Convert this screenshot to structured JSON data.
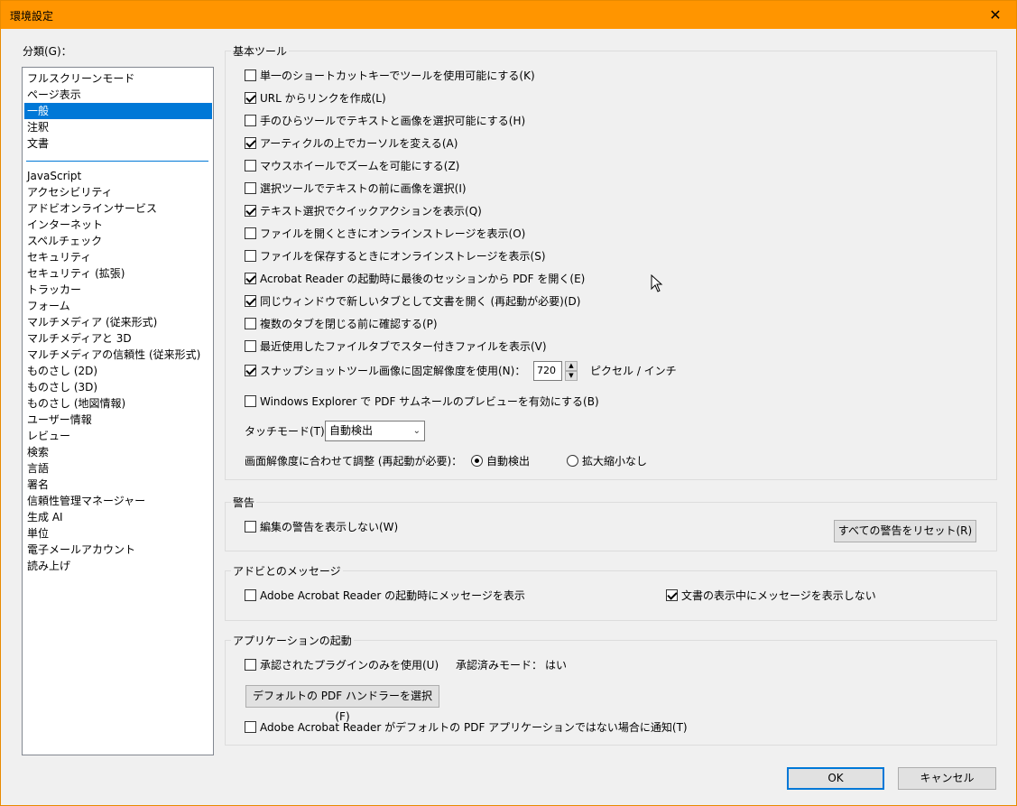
{
  "window": {
    "title": "環境設定"
  },
  "categories": {
    "label": "分類(G)：",
    "top_items": [
      "フルスクリーンモード",
      "ページ表示",
      "一般",
      "注釈",
      "文書"
    ],
    "selected": "一般",
    "bottom_items": [
      "JavaScript",
      "アクセシビリティ",
      "アドビオンラインサービス",
      "インターネット",
      "スペルチェック",
      "セキュリティ",
      "セキュリティ (拡張)",
      "トラッカー",
      "フォーム",
      "マルチメディア (従来形式)",
      "マルチメディアと 3D",
      "マルチメディアの信頼性 (従来形式)",
      "ものさし (2D)",
      "ものさし (3D)",
      "ものさし (地図情報)",
      "ユーザー情報",
      "レビュー",
      "検索",
      "言語",
      "署名",
      "信頼性管理マネージャー",
      "生成 AI",
      "単位",
      "電子メールアカウント",
      "読み上げ"
    ]
  },
  "basic_tools": {
    "title": "基本ツール",
    "options": [
      {
        "label": "単一のショートカットキーでツールを使用可能にする(K)",
        "checked": false
      },
      {
        "label": "URL からリンクを作成(L)",
        "checked": true
      },
      {
        "label": "手のひらツールでテキストと画像を選択可能にする(H)",
        "checked": false
      },
      {
        "label": "アーティクルの上でカーソルを変える(A)",
        "checked": true
      },
      {
        "label": "マウスホイールでズームを可能にする(Z)",
        "checked": false
      },
      {
        "label": "選択ツールでテキストの前に画像を選択(I)",
        "checked": false
      },
      {
        "label": "テキスト選択でクイックアクションを表示(Q)",
        "checked": true
      },
      {
        "label": "ファイルを開くときにオンラインストレージを表示(O)",
        "checked": false
      },
      {
        "label": "ファイルを保存するときにオンラインストレージを表示(S)",
        "checked": false
      },
      {
        "label": "Acrobat Reader の起動時に最後のセッションから PDF を開く(E)",
        "checked": true
      },
      {
        "label": "同じウィンドウで新しいタブとして文書を開く (再起動が必要)(D)",
        "checked": true
      },
      {
        "label": "複数のタブを閉じる前に確認する(P)",
        "checked": false
      },
      {
        "label": "最近使用したファイルタブでスター付きファイルを表示(V)",
        "checked": false
      }
    ],
    "snapshot": {
      "label": "スナップショットツール画像に固定解像度を使用(N)：",
      "checked": true,
      "value": "720",
      "unit": "ピクセル / インチ"
    },
    "windows_explorer": {
      "label": "Windows Explorer で PDF サムネールのプレビューを有効にする(B)",
      "checked": false
    },
    "touch_mode": {
      "label": "タッチモード(T)：",
      "value": "自動検出"
    },
    "resolution": {
      "label": "画面解像度に合わせて調整 (再起動が必要)：",
      "option_auto": "自動検出",
      "option_none": "拡大縮小なし",
      "selected": "自動検出"
    }
  },
  "warnings": {
    "title": "警告",
    "option": {
      "label": "編集の警告を表示しない(W)",
      "checked": false
    },
    "reset_button": "すべての警告をリセット(R)"
  },
  "messages": {
    "title": "アドビとのメッセージ",
    "option_launch": {
      "label": "Adobe Acrobat Reader の起動時にメッセージを表示",
      "checked": false
    },
    "option_viewing": {
      "label": "文書の表示中にメッセージを表示しない",
      "checked": true
    }
  },
  "app_startup": {
    "title": "アプリケーションの起動",
    "option_plugins": {
      "label": "承認されたプラグインのみを使用(U)",
      "checked": false
    },
    "certified_mode_label": "承認済みモード：",
    "certified_mode_value": "はい",
    "default_handler_button": "デフォルトの PDF ハンドラーを選択(F)",
    "option_notify": {
      "label": "Adobe Acrobat Reader がデフォルトの PDF アプリケーションではない場合に通知(T)",
      "checked": false
    }
  },
  "footer": {
    "ok": "OK",
    "cancel": "キャンセル"
  },
  "colors": {
    "titlebar": "#ff9500",
    "selection": "#0078d7"
  }
}
